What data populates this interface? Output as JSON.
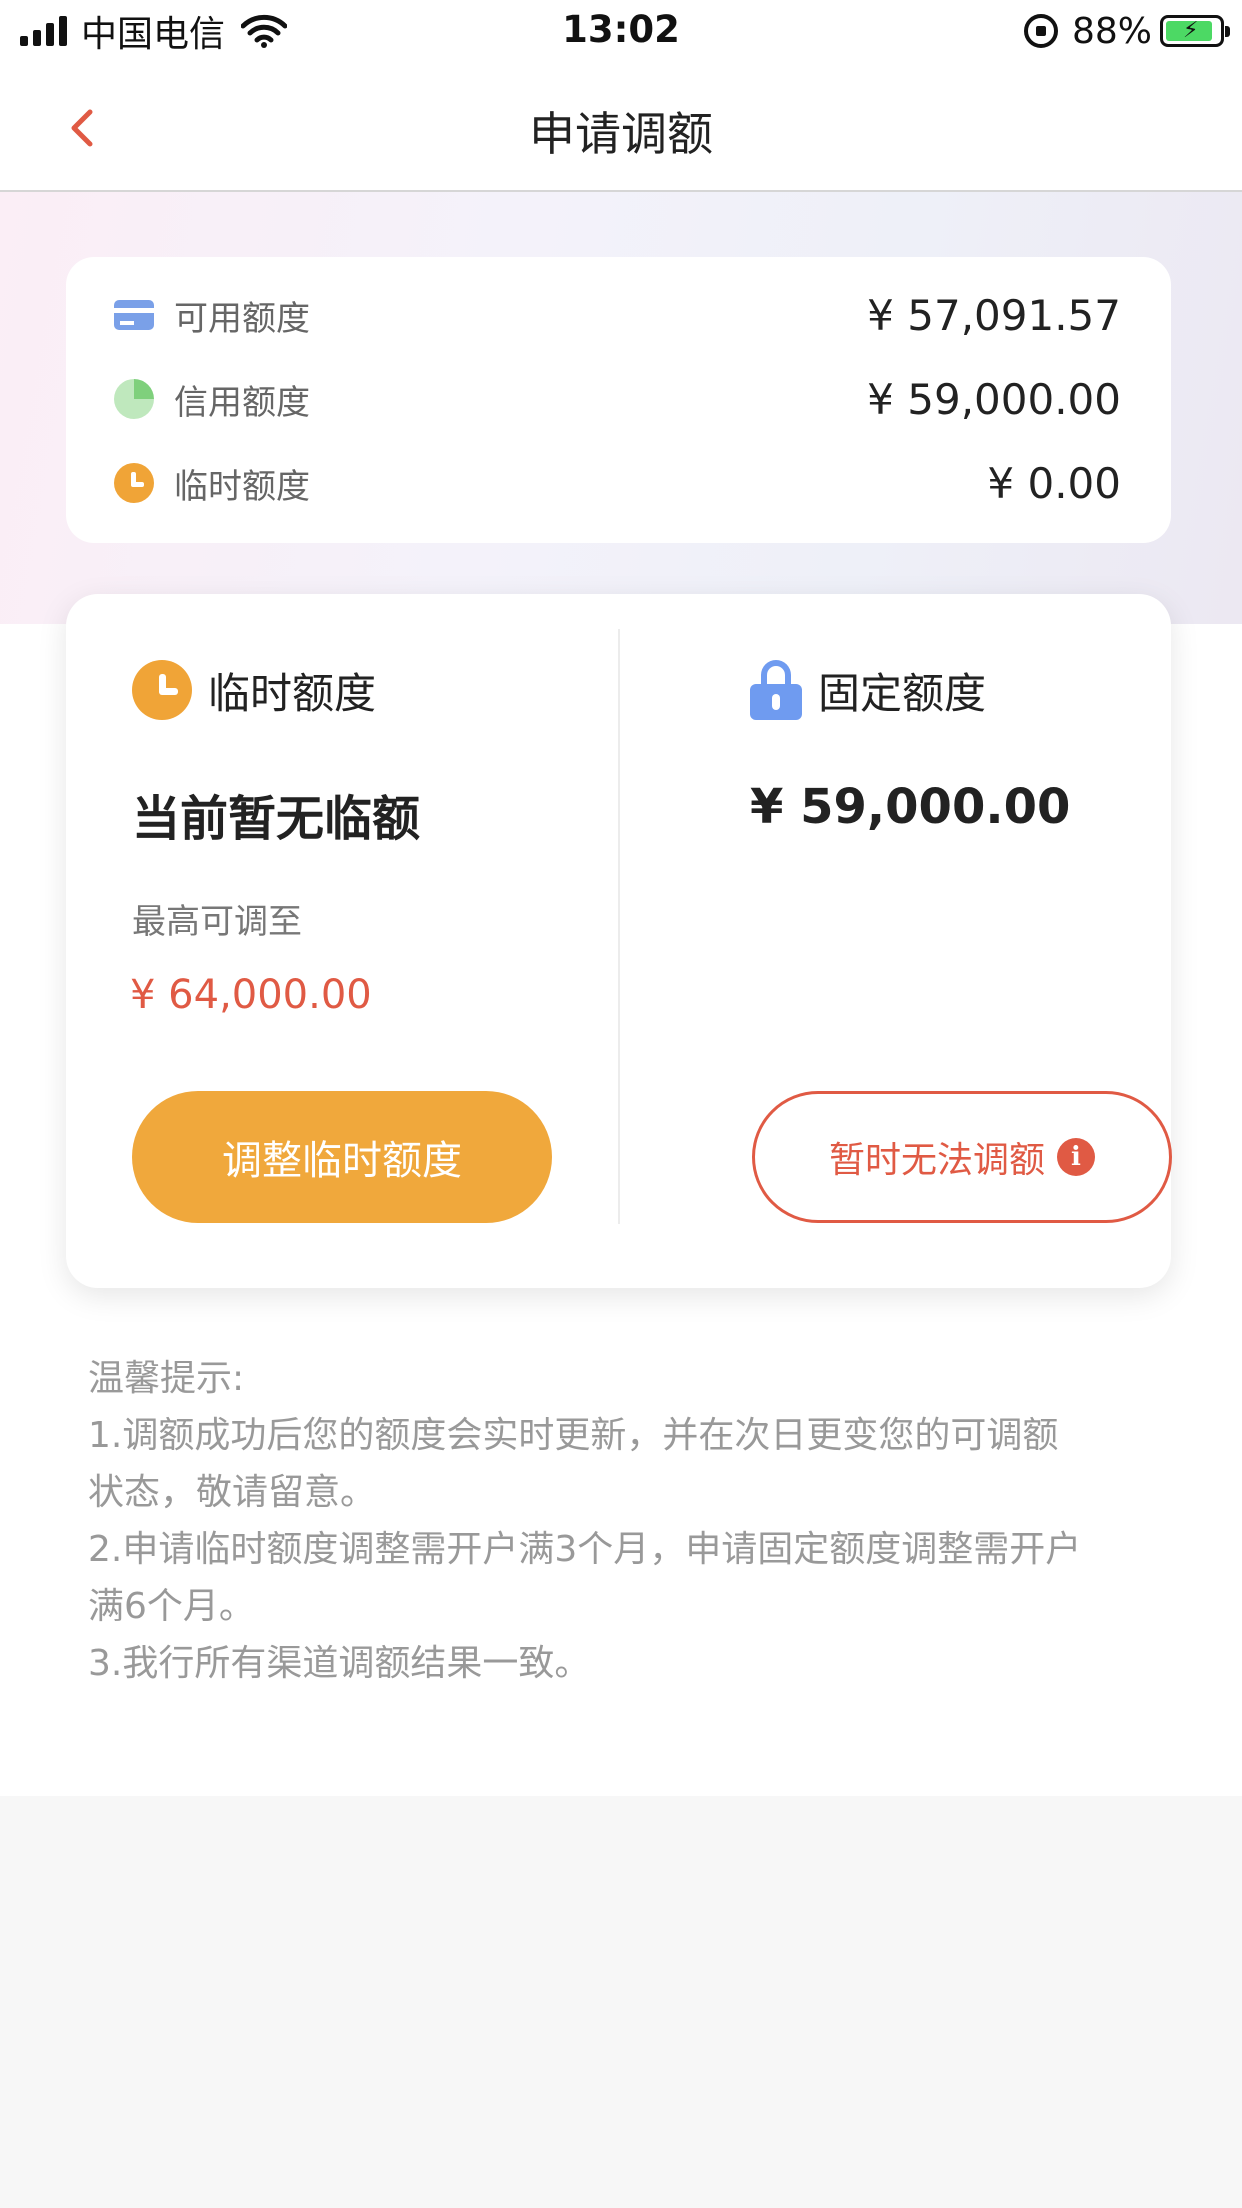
{
  "status_bar": {
    "carrier": "中国电信",
    "time": "13:02",
    "battery_percent": "88%",
    "battery_level": 0.88,
    "battery_color": "#4cd964"
  },
  "nav": {
    "title": "申请调额",
    "back_icon": "chevron-left-icon",
    "accent_color": "#e05a44"
  },
  "summary": {
    "rows": [
      {
        "icon": "card-icon",
        "label": "可用额度",
        "value": "¥ 57,091.57"
      },
      {
        "icon": "pie-chart-icon",
        "label": "信用额度",
        "value": "¥ 59,000.00"
      },
      {
        "icon": "clock-icon",
        "label": "临时额度",
        "value": "¥ 0.00"
      }
    ]
  },
  "temporary": {
    "title": "临时额度",
    "status": "当前暂无临额",
    "max_label": "最高可调至",
    "max_value": "¥ 64,000.00",
    "button_label": "调整临时额度",
    "button_color": "#f0a83c"
  },
  "fixed": {
    "title": "固定额度",
    "value": "¥ 59,000.00",
    "button_label": "暂时无法调额",
    "info_icon_glyph": "i"
  },
  "tips": {
    "heading": "温馨提示:",
    "lines": [
      "1.调额成功后您的额度会实时更新，并在次日更变您的可调额",
      "状态，敬请留意。",
      "2.申请临时额度调整需开户满3个月，申请固定额度调整需开户",
      "满6个月。",
      "3.我行所有渠道调额结果一致。"
    ]
  }
}
